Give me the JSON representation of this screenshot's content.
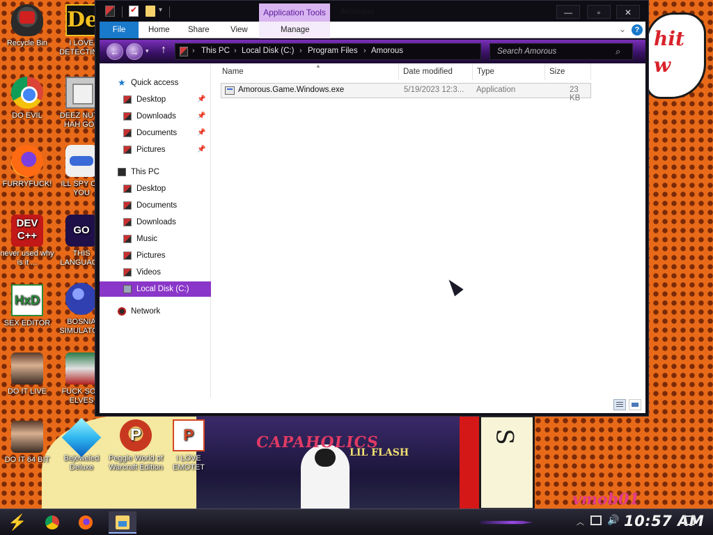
{
  "wallpaper": {
    "speech_text": "hit\nw",
    "poster_title": "CAPAHOLICS",
    "poster_sub": "LIL FLASH",
    "watermark": "vmob01"
  },
  "desktop_icons": [
    {
      "label": "Recycle Bin",
      "icon": "recycle-bin-icon"
    },
    {
      "label": "I LOVE DETECTING",
      "icon": "detective-app-icon"
    },
    {
      "label": "DO EVIL",
      "icon": "chrome-icon"
    },
    {
      "label": "DEEZ NUTS HAH GOT",
      "icon": "stacked-windows-icon"
    },
    {
      "label": "FURRYFUCK!",
      "icon": "firefox-icon"
    },
    {
      "label": "ILL SPY ON YOU",
      "icon": "spy-app-icon"
    },
    {
      "label": "never used why is it ...",
      "icon": "dev-cpp-icon",
      "glyph": "DEV C++"
    },
    {
      "label": "THIS LANGUAGE",
      "icon": "goland-icon",
      "glyph": "GO"
    },
    {
      "label": "SEX EDITOR",
      "icon": "hxd-icon",
      "glyph": "HxD"
    },
    {
      "label": "BOSNIA SIMULATOR",
      "icon": "bosnia-game-icon"
    },
    {
      "label": "DO IT LIVE",
      "icon": "portrait-icon"
    },
    {
      "label": "FUCK SON ELVES",
      "icon": "elves-game-icon"
    },
    {
      "label": "DO IT 64 BIT",
      "icon": "portrait-64-icon"
    },
    {
      "label": "Bejeweled Deluxe",
      "icon": "bejeweled-icon"
    },
    {
      "label": "Peggle World of Warcraft Edition",
      "icon": "peggle-icon",
      "glyph": "P"
    },
    {
      "label": "I LOVE EMOTET",
      "icon": "powerpoint-icon",
      "glyph": "P"
    }
  ],
  "window": {
    "title": "Amorous",
    "context_tab": "Application Tools",
    "ribbon_tabs": {
      "file": "File",
      "home": "Home",
      "share": "Share",
      "view": "View",
      "manage": "Manage"
    },
    "help": "?",
    "address": {
      "crumbs": [
        "This PC",
        "Local Disk (C:)",
        "Program Files",
        "Amorous"
      ]
    },
    "search_placeholder": "Search Amorous",
    "nav": {
      "quick_access": "Quick access",
      "qa_items": [
        "Desktop",
        "Downloads",
        "Documents",
        "Pictures"
      ],
      "this_pc": "This PC",
      "pc_items": [
        "Desktop",
        "Documents",
        "Downloads",
        "Music",
        "Pictures",
        "Videos"
      ],
      "selected": "Local Disk (C:)",
      "network": "Network"
    },
    "columns": {
      "name": "Name",
      "date": "Date modified",
      "type": "Type",
      "size": "Size"
    },
    "files": [
      {
        "name": "Amorous.Game.Windows.exe",
        "date": "5/19/2023 12:3...",
        "type": "Application",
        "size": "23 KB"
      }
    ]
  },
  "taskbar": {
    "clock": "10:57 AM",
    "apps": [
      "chrome-icon",
      "firefox-icon",
      "file-explorer-icon"
    ]
  }
}
